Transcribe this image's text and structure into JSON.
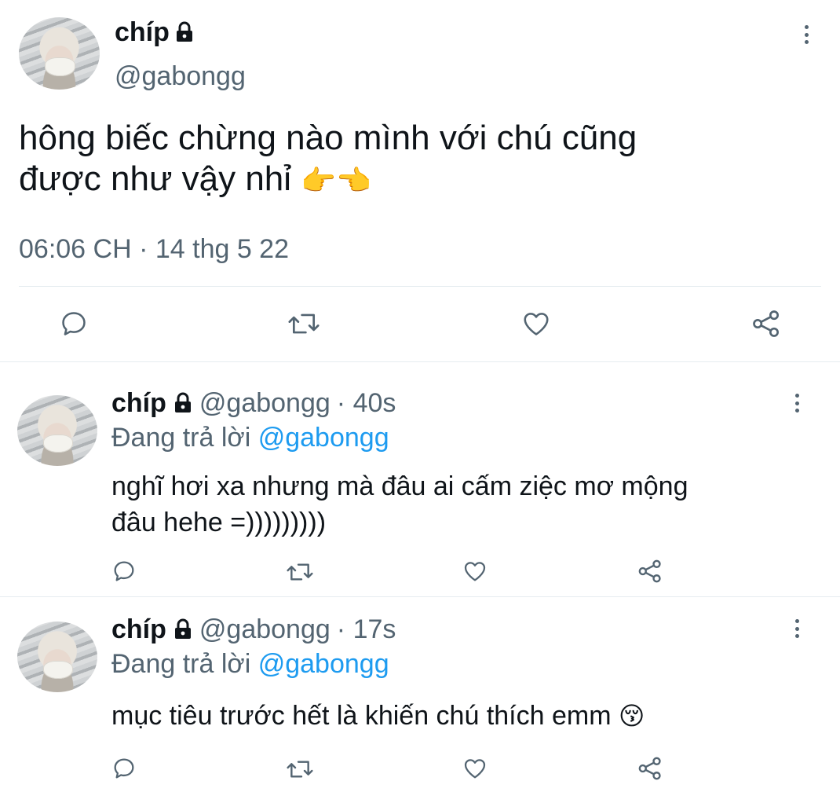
{
  "main_tweet": {
    "display_name": "chíp",
    "handle": "@gabongg",
    "text_line1": "hông biếc chừng nào mình với chú cũng",
    "text_line2": "được như vậy nhỉ",
    "emoji": "👉👈",
    "timestamp": "06:06 CH · 14 thg 5 22"
  },
  "replies": [
    {
      "display_name": "chíp",
      "handle": "@gabongg",
      "time": "· 40s",
      "replying_prefix": "Đang trả lời",
      "replying_to": "@gabongg",
      "text_line1": "nghĩ hơi xa nhưng mà đâu ai cấm ziệc mơ mộng",
      "text_line2": "đâu hehe =)))))))))"
    },
    {
      "display_name": "chíp",
      "handle": "@gabongg",
      "time": "· 17s",
      "replying_prefix": "Đang trả lời",
      "replying_to": "@gabongg",
      "text_line1": "mục tiêu trước hết là khiến chú thích emm",
      "emoji": "😚"
    }
  ],
  "icons": {
    "reply": "reply-icon",
    "retweet": "retweet-icon",
    "like": "heart-icon",
    "share": "share-icon",
    "more": "more-icon",
    "lock": "lock-icon"
  },
  "colors": {
    "text": "#0f1419",
    "secondary": "#536471",
    "link": "#1d9bf0",
    "divider": "#e6ecf0"
  }
}
